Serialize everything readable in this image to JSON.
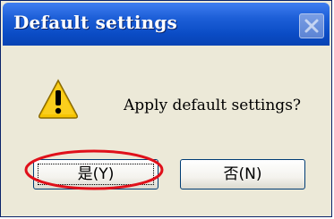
{
  "dialog": {
    "title": "Default settings",
    "message": "Apply default settings?",
    "icon": "warning-icon",
    "close_icon": "close-icon"
  },
  "buttons": {
    "yes_label": "是(Y)",
    "no_label": "否(N)"
  },
  "colors": {
    "titlebar": "#0a4bc4",
    "dialog_bg": "#ece9d8",
    "annotation": "#e0101a",
    "warning_yellow": "#f5c400"
  }
}
